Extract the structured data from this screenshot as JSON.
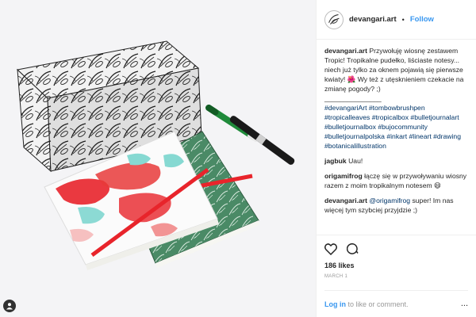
{
  "header": {
    "username": "devangari.art",
    "separator": "•",
    "follow_label": "Follow"
  },
  "comments": [
    {
      "user": "devangari.art",
      "text": "Przywołuję wiosnę zestawem Tropic! Tropikalne pudełko, liściaste notesy... niech już tylko za oknem pojawią się pierwsze kwiaty! 🌺 Wy też z utęsknieniem czekacie na zmianę pogody? ;)",
      "separator": "_______________",
      "hashtags": "#devangariArt #tombowbrushpen #tropicalleaves #tropicalbox #bulletjournalart #bulletjournalbox #bujocommunity #bulletjournalpolska #inkart #lineart #drawing #botanicalillustration"
    },
    {
      "user": "jagbuk",
      "text": "Uau!"
    },
    {
      "user": "origamifrog",
      "text": "łączę się w przywoływaniu wiosny razem z moim tropikalnym notesem 😄"
    },
    {
      "user": "devangari.art",
      "mention": "@origamifrog",
      "text": "super! Im nas więcej tym szybciej przyjdzie ;)"
    }
  ],
  "actions": {
    "like_icon": "heart-icon",
    "comment_icon": "comment-icon",
    "likes": "186 likes",
    "date": "MARCH 1"
  },
  "login": {
    "link": "Log in",
    "text": "to like or comment.",
    "more": "..."
  },
  "colors": {
    "link_blue": "#3897f0",
    "hashtag": "#003569",
    "notebook_red": "#e8242b",
    "notebook_green": "#3f7e5a"
  }
}
